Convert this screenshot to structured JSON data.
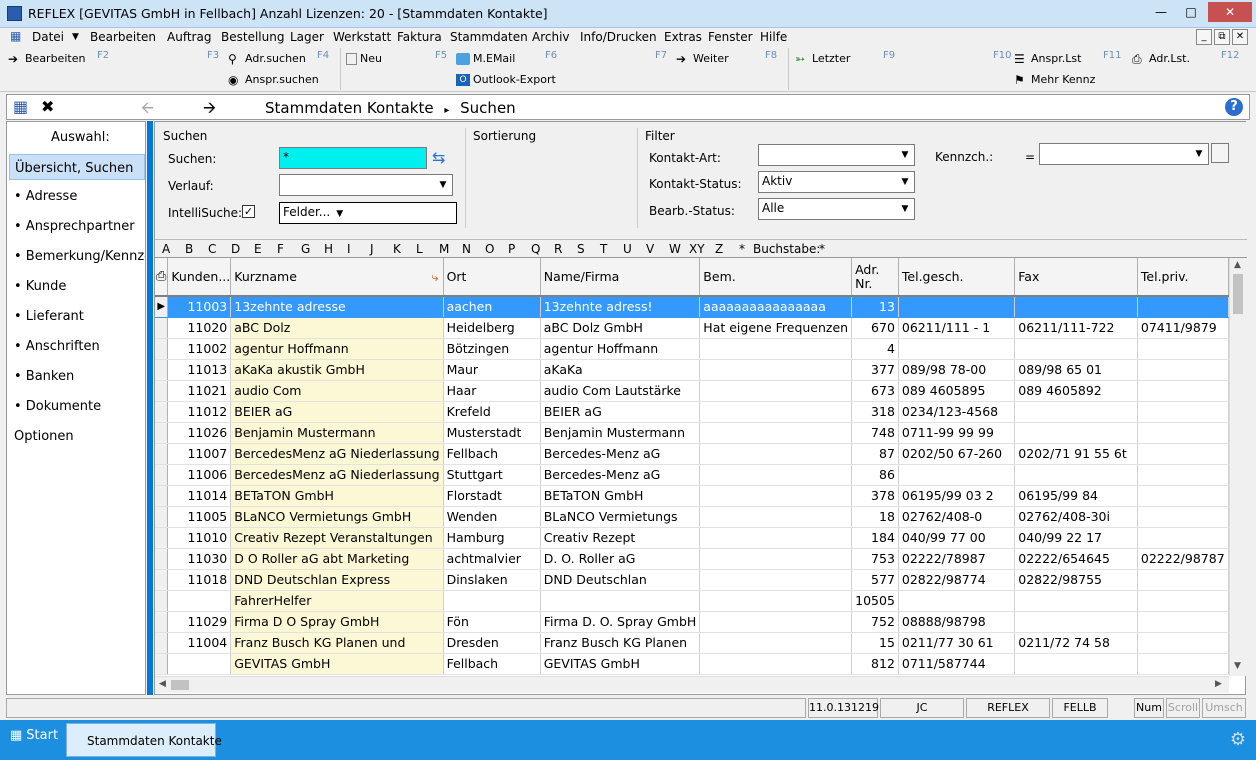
{
  "window": {
    "title": "REFLEX [GEVITAS GmbH in Fellbach] Anzahl Lizenzen: 20 - [Stammdaten Kontakte]"
  },
  "menu": [
    "Datei",
    "Bearbeiten",
    "Auftrag",
    "Bestellung",
    "Lager",
    "Werkstatt",
    "Faktura",
    "Stammdaten",
    "Archiv",
    "Info/Drucken",
    "Extras",
    "Fenster",
    "Hilfe"
  ],
  "toolbar": {
    "bearbeiten": "Bearbeiten",
    "adr_suchen": "Adr.suchen",
    "anspr_suchen": "Anspr.suchen",
    "neu": "Neu",
    "m_email": "M.EMail",
    "outlook_export": "Outlook-Export",
    "weiter": "Weiter",
    "letzter": "Letzter",
    "anspr_lst": "Anspr.Lst",
    "mehr_kennz": "Mehr Kennz",
    "adr_lst": "Adr.Lst.",
    "fkeys": [
      "F2",
      "F3",
      "F4",
      "F5",
      "F6",
      "F7",
      "F8",
      "F9",
      "F10",
      "F11",
      "F12"
    ]
  },
  "nav": {
    "crumb_main": "Stammdaten Kontakte",
    "crumb_sub": "Suchen",
    "help": "?"
  },
  "sidebar": {
    "header": "Auswahl:",
    "selected": "Übersicht, Suchen",
    "items": [
      "• Adresse",
      "• Ansprechpartner",
      "• Bemerkung/Kennzeichen",
      "• Kunde",
      "• Lieferant",
      "• Anschriften",
      "• Banken",
      "• Dokumente",
      "Optionen"
    ]
  },
  "search": {
    "group_suchen": "Suchen",
    "group_sortierung": "Sortierung",
    "group_filter": "Filter",
    "suchen_label": "Suchen:",
    "suchen_value": "*",
    "verlauf_label": "Verlauf:",
    "verlauf_value": "",
    "intelli_label": "IntelliSuche:",
    "intelli_checked": true,
    "felder_label": "Felder...",
    "kontakt_art_label": "Kontakt-Art:",
    "kontakt_art_value": "",
    "kontakt_status_label": "Kontakt-Status:",
    "kontakt_status_value": "Aktiv",
    "bearb_status_label": "Bearb.-Status:",
    "bearb_status_value": "Alle",
    "kennzch_label": "Kennzch.:",
    "kennzch_op": "=",
    "kennzch_value": ""
  },
  "alphabet": {
    "letters": [
      "A",
      "B",
      "C",
      "D",
      "E",
      "F",
      "G",
      "H",
      "I",
      "J",
      "K",
      "L",
      "M",
      "N",
      "O",
      "P",
      "Q",
      "R",
      "S",
      "T",
      "U",
      "V",
      "W",
      "XY",
      "Z",
      "*"
    ],
    "buchstabe_label": "Buchstabe:",
    "buchstabe_value": "*"
  },
  "table": {
    "columns": [
      "Kunden...",
      "Kurzname",
      "Ort",
      "Name/Firma",
      "Bem.",
      "Adr. Nr.",
      "Tel.gesch.",
      "Fax",
      "Tel.priv."
    ],
    "rows": [
      [
        "11003",
        "13zehnte adresse",
        "aachen",
        "13zehnte adress!",
        "aaaaaaaaaaaaaaaa",
        "13",
        "",
        "",
        ""
      ],
      [
        "11020",
        "aBC Dolz",
        "Heidelberg",
        "aBC Dolz GmbH",
        "Hat eigene Frequenzen",
        "670",
        "06211/111 - 1",
        "06211/111-722",
        "07411/9879"
      ],
      [
        "11002",
        "agentur Hoffmann",
        "Bötzingen",
        "agentur Hoffmann",
        "",
        "4",
        "",
        "",
        ""
      ],
      [
        "11013",
        "aKaKa akustik GmbH",
        "Maur",
        "aKaKa",
        "",
        "377",
        "089/98 78-00",
        "089/98 65 01",
        ""
      ],
      [
        "11021",
        "audio Com",
        "Haar",
        "audio Com Lautstärke",
        "",
        "673",
        "089 4605895",
        "089 4605892",
        ""
      ],
      [
        "11012",
        "BEIER aG",
        "Krefeld",
        "BEIER aG",
        "",
        "318",
        "0234/123-4568",
        "",
        ""
      ],
      [
        "11026",
        "Benjamin Mustermann",
        "Musterstadt",
        "Benjamin Mustermann",
        "",
        "748",
        "0711-99 99 99",
        "",
        ""
      ],
      [
        "11007",
        "BercedesMenz aG Niederlassung",
        "Fellbach",
        "Bercedes-Menz aG",
        "",
        "87",
        "0202/50 67-260",
        "0202/71 91 55 6t",
        ""
      ],
      [
        "11006",
        "BercedesMenz aG Niederlassung",
        "Stuttgart",
        "Bercedes-Menz aG",
        "",
        "86",
        "",
        "",
        ""
      ],
      [
        "11014",
        "BETaTON GmbH",
        "Florstadt",
        "BETaTON GmbH",
        "",
        "378",
        "06195/99 03 2",
        "06195/99 84",
        ""
      ],
      [
        "11005",
        "BLaNCO Vermietungs GmbH",
        "Wenden",
        "BLaNCO Vermietungs",
        "",
        "18",
        "02762/408-0",
        "02762/408-30i",
        ""
      ],
      [
        "11010",
        "Creativ Rezept Veranstaltungen",
        "Hamburg",
        "Creativ Rezept",
        "",
        "184",
        "040/99 77 00",
        "040/99 22 17",
        ""
      ],
      [
        "11030",
        "D O Roller aG abt Marketing",
        "achtmalvier",
        "D. O. Roller aG",
        "",
        "753",
        "02222/78987",
        "02222/654645",
        "02222/98787"
      ],
      [
        "11018",
        "DND Deutschlan Express",
        "Dinslaken",
        "DND Deutschlan",
        "",
        "577",
        "02822/98774",
        "02822/98755",
        ""
      ],
      [
        "",
        "FahrerHelfer",
        "",
        "",
        "",
        "10505",
        "",
        "",
        ""
      ],
      [
        "11029",
        "Firma D O Spray GmbH",
        "Fön",
        "Firma D. O. Spray GmbH",
        "",
        "752",
        "08888/98798",
        "",
        ""
      ],
      [
        "11004",
        "Franz Busch KG Planen und",
        "Dresden",
        "Franz Busch KG Planen",
        "",
        "15",
        "0211/77 30 61",
        "0211/72 74 58",
        ""
      ],
      [
        "",
        "GEVITAS GmbH",
        "Fellbach",
        "GEVITAS GmbH",
        "",
        "812",
        "0711/587744",
        "",
        ""
      ]
    ]
  },
  "status": {
    "version": "11.0.131219",
    "user": "JC",
    "app": "REFLEX",
    "branch": "FELLB",
    "num": "Num",
    "scroll": "Scroll",
    "umsch": "Umsch"
  },
  "taskbar": {
    "start": "Start",
    "item": "Stammdaten Kontakte"
  }
}
